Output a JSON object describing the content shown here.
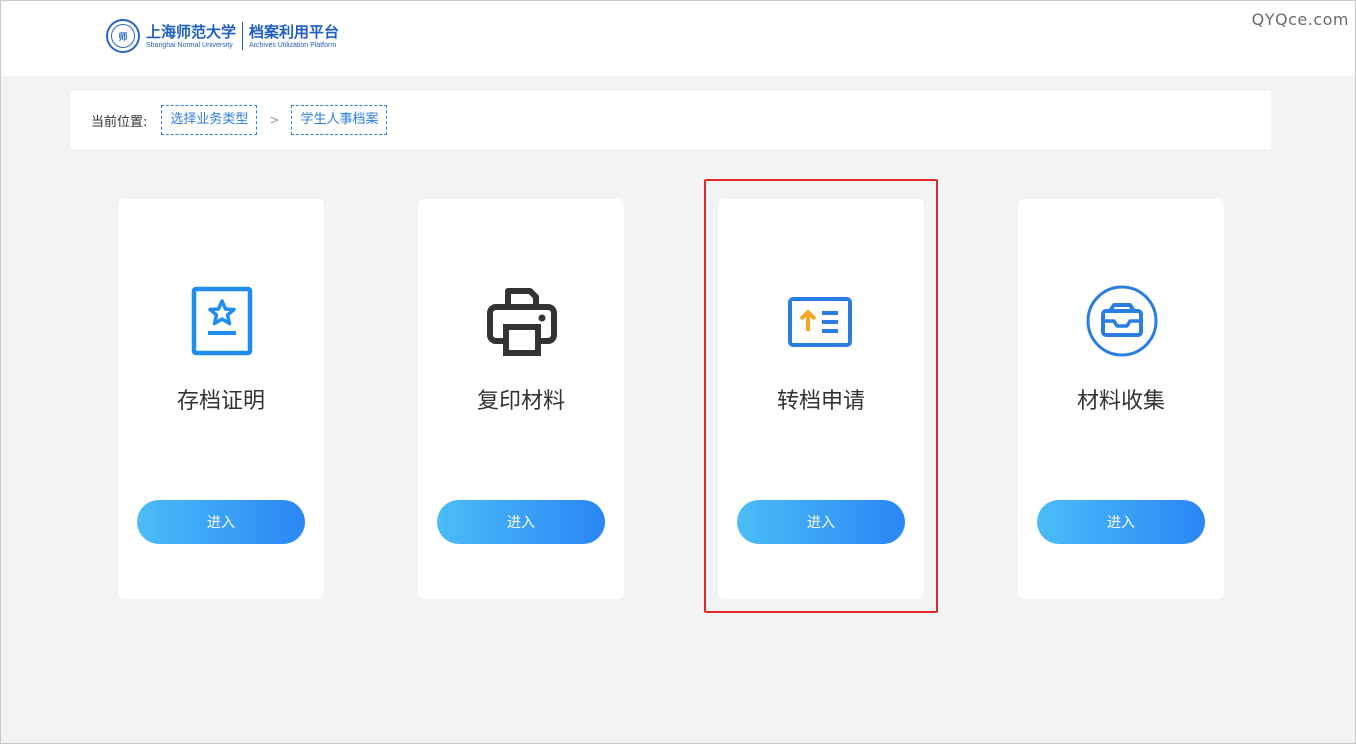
{
  "header": {
    "logo_seal_text": "师",
    "logo_cn_name": "上海师范大学",
    "logo_en_name": "Shanghai Normal University",
    "platform_cn_name": "档案利用平台",
    "platform_en_name": "Archives Utilization Platform",
    "watermark": "QYQce.com"
  },
  "breadcrumb": {
    "label": "当前位置:",
    "items": [
      "选择业务类型",
      "学生人事档案"
    ],
    "separator": ">"
  },
  "cards": [
    {
      "title": "存档证明",
      "button": "进入",
      "icon": "certificate-star-icon"
    },
    {
      "title": "复印材料",
      "button": "进入",
      "icon": "printer-icon"
    },
    {
      "title": "转档申请",
      "button": "进入",
      "icon": "transfer-list-icon"
    },
    {
      "title": "材料收集",
      "button": "进入",
      "icon": "inbox-tray-icon"
    }
  ],
  "colors": {
    "accent_blue": "#2a86f5",
    "accent_light": "#4bbdf7",
    "highlight_red": "#e02a2a",
    "arrow_orange": "#f5a623"
  },
  "highlighted_card": "转档申请"
}
